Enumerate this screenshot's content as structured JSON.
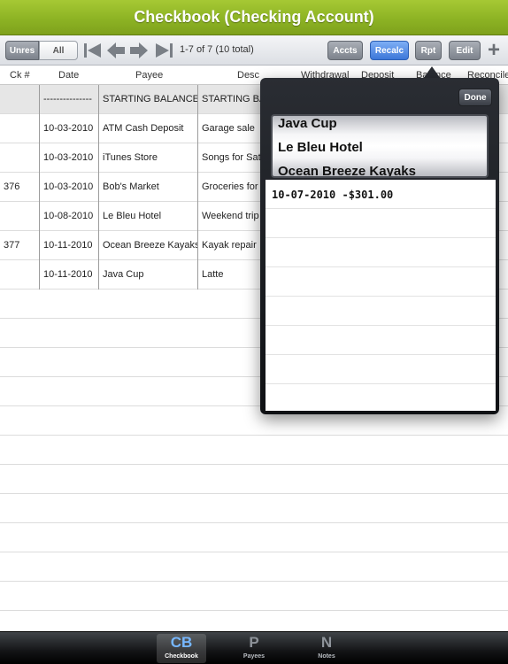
{
  "app": {
    "title": "Checkbook (Checking Account)"
  },
  "toolbar": {
    "unres_label": "Unres",
    "all_label": "All",
    "range_text": "1-7 of 7 (10 total)",
    "accts_label": "Accts",
    "recalc_label": "Recalc",
    "rpt_label": "Rpt",
    "edit_label": "Edit",
    "add_label": "+"
  },
  "columns": {
    "ck": "Ck #",
    "date": "Date",
    "payee": "Payee",
    "desc": "Desc",
    "withdrawal": "Withdrawal",
    "deposit": "Deposit",
    "balance": "Balance",
    "reconciled": "Reconciled"
  },
  "rows": [
    {
      "ck": "",
      "date": "---------------",
      "payee": "STARTING BALANCE",
      "desc": "STARTING BA"
    },
    {
      "ck": "",
      "date": "10-03-2010",
      "payee": "ATM Cash Deposit",
      "desc": "Garage sale"
    },
    {
      "ck": "",
      "date": "10-03-2010",
      "payee": "iTunes Store",
      "desc": "Songs for Sat"
    },
    {
      "ck": "376",
      "date": "10-03-2010",
      "payee": "Bob's Market",
      "desc": "Groceries for t"
    },
    {
      "ck": "",
      "date": "10-08-2010",
      "payee": "Le Bleu Hotel",
      "desc": "Weekend trip"
    },
    {
      "ck": "377",
      "date": "10-11-2010",
      "payee": "Ocean Breeze Kayaks",
      "desc": "Kayak repair"
    },
    {
      "ck": "",
      "date": "10-11-2010",
      "payee": "Java Cup",
      "desc": "Latte"
    }
  ],
  "popover": {
    "done_label": "Done",
    "picker_items": [
      "Java Cup",
      "Le Bleu Hotel",
      "Ocean Breeze Kayaks"
    ],
    "entries": [
      "10-07-2010 -$301.00"
    ]
  },
  "tabs": [
    {
      "glyph": "CB",
      "label": "Checkbook"
    },
    {
      "glyph": "P",
      "label": "Payees"
    },
    {
      "glyph": "N",
      "label": "Notes"
    }
  ],
  "colors": {
    "title_bar": "#8db324",
    "accent_blue": "#3c77d9",
    "tab_active": "#76b7ff"
  }
}
